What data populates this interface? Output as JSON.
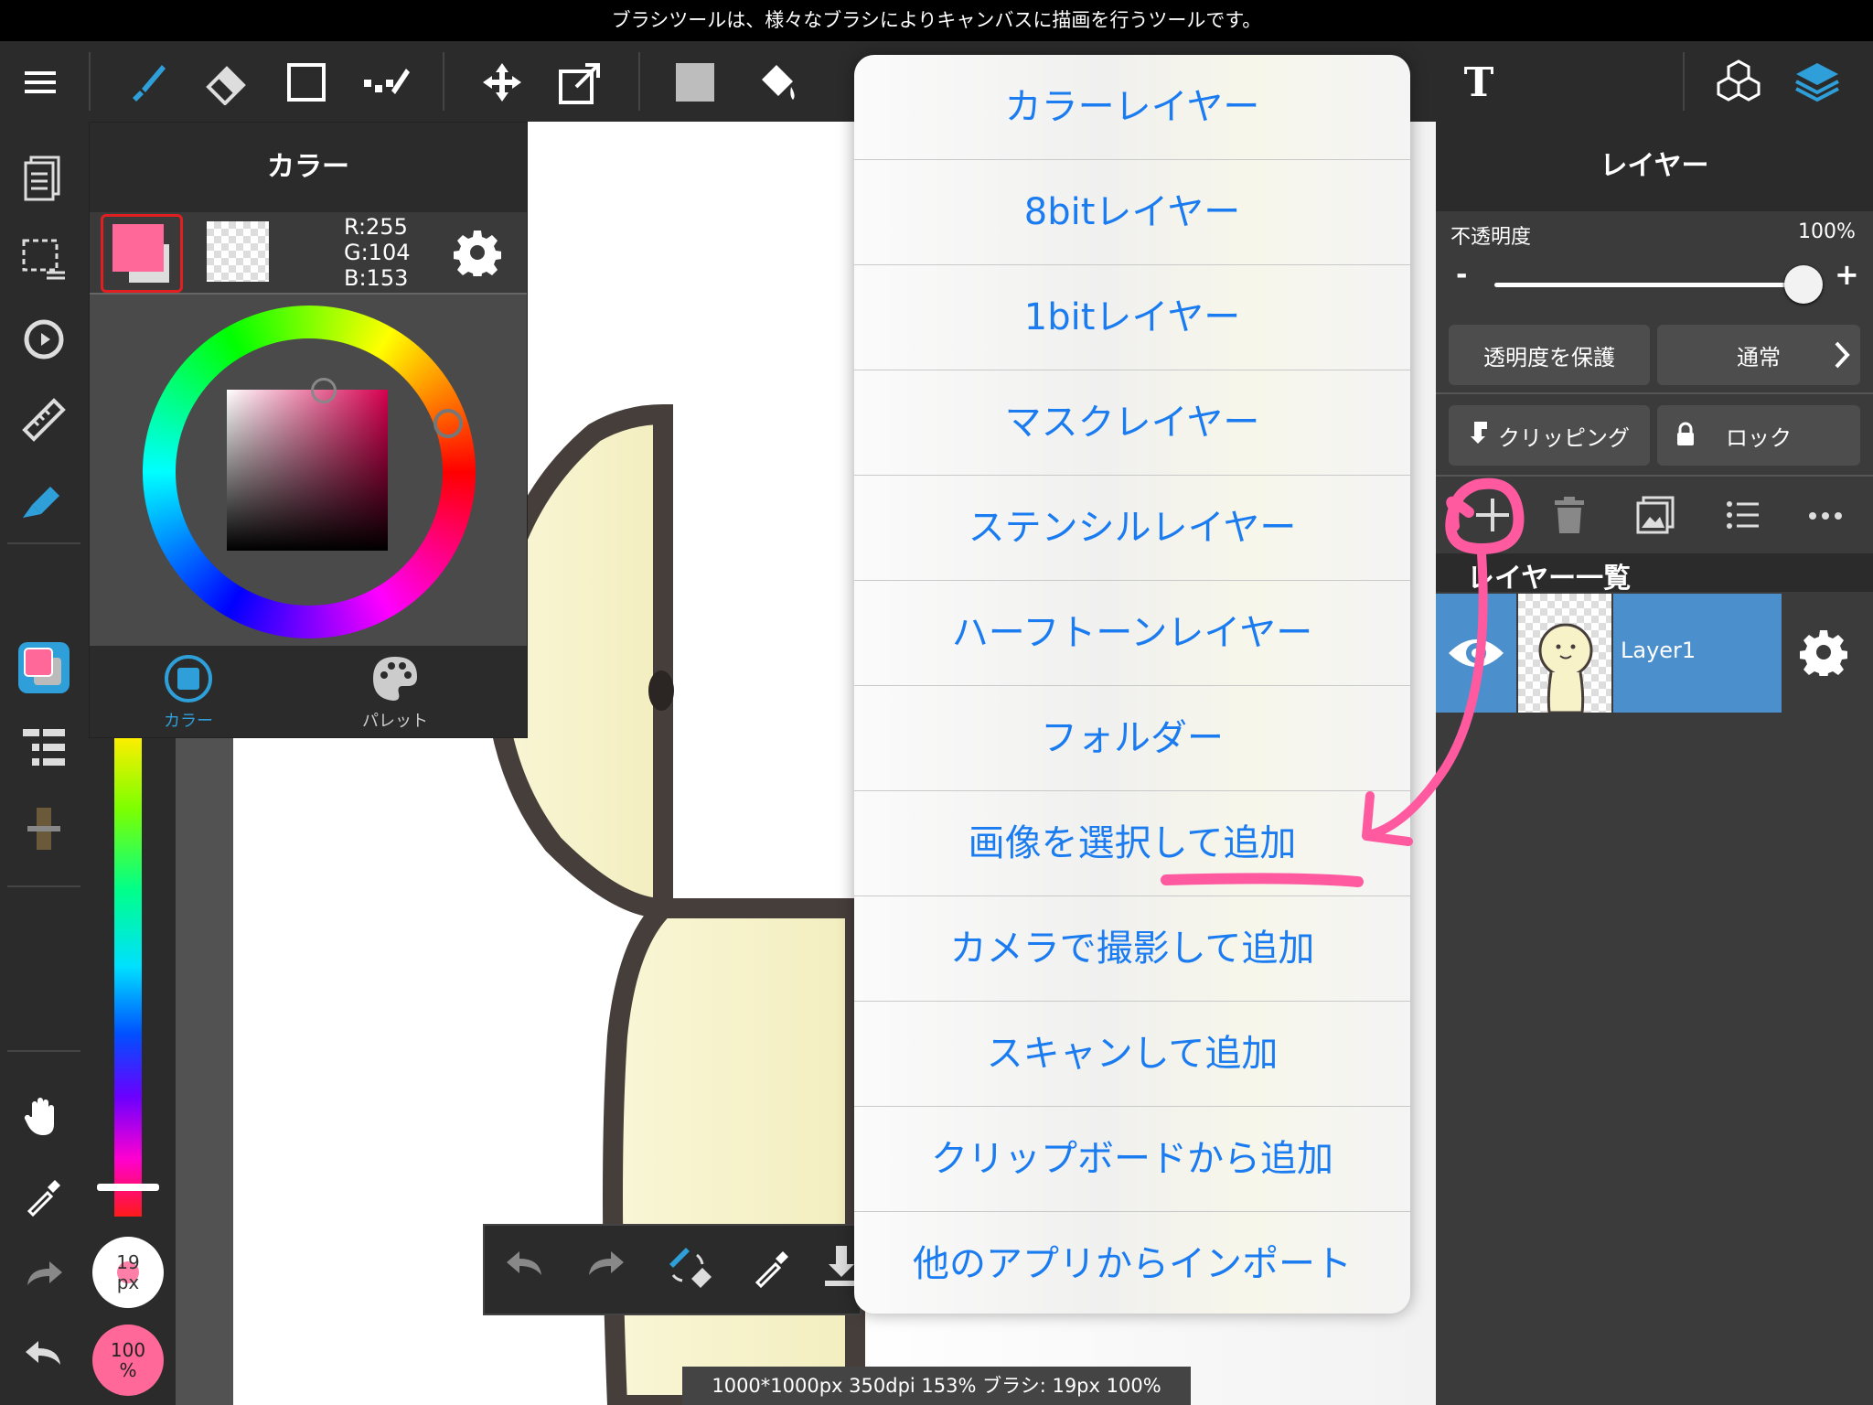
{
  "hint_text": "ブラシツールは、様々なブラシによりキャンバスに描画を行うツールです。",
  "color_panel": {
    "title": "カラー",
    "main_color": "#ff6899",
    "rgb": {
      "r": "R:255",
      "g": "G:104",
      "b": "B:153"
    },
    "tabs": [
      {
        "label": "カラー"
      },
      {
        "label": "パレット"
      }
    ]
  },
  "brush_size": {
    "line1": "19",
    "line2": "px"
  },
  "opacity_badge": {
    "line1": "100",
    "line2": "%"
  },
  "layer_panel": {
    "title": "レイヤー",
    "opacity_label": "不透明度",
    "opacity_value": "100%",
    "opacity_fraction": 1.0,
    "minus": "-",
    "plus": "+",
    "protect_alpha": "透明度を保護",
    "blend_mode": "通常",
    "clipping": "クリッピング",
    "lock": "ロック",
    "list_header": "レイヤー一覧",
    "layer_name": "Layer1"
  },
  "menu_items": [
    "カラーレイヤー",
    "8bitレイヤー",
    "1bitレイヤー",
    "マスクレイヤー",
    "ステンシルレイヤー",
    "ハーフトーンレイヤー",
    "フォルダー",
    "画像を選択して追加",
    "カメラで撮影して追加",
    "スキャンして追加",
    "クリップボードから追加",
    "他のアプリからインポート"
  ],
  "text_tool_glyph": "T",
  "status_text": "1000*1000px 350dpi 153% ブラシ: 19px 100%",
  "colors": {
    "accent": "#1a7cf0",
    "highlight": "#ff5aa0",
    "selected_layer": "#4b90cc"
  }
}
